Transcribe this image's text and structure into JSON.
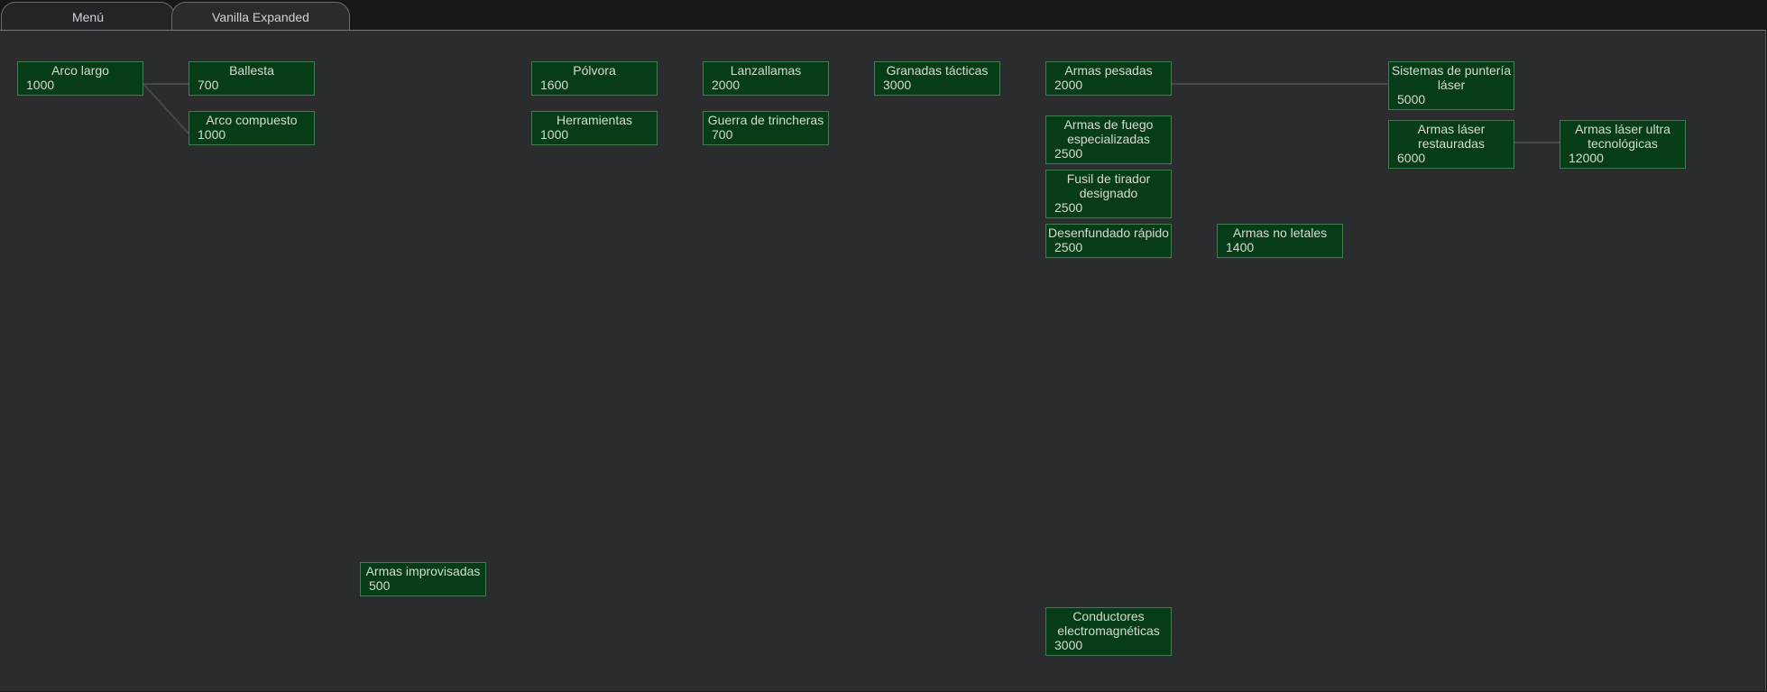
{
  "tabs": [
    {
      "label": "Menú"
    },
    {
      "label": "Vanilla Expanded"
    }
  ],
  "active_tab": "Vanilla Expanded",
  "research": {
    "arco_largo": {
      "label": "Arco largo",
      "cost": "1000"
    },
    "ballesta": {
      "label": "Ballesta",
      "cost": "700"
    },
    "arco_compuesto": {
      "label": "Arco compuesto",
      "cost": "1000"
    },
    "polvora": {
      "label": "Pólvora",
      "cost": "1600"
    },
    "herramientas": {
      "label": "Herramientas",
      "cost": "1000"
    },
    "lanzallamas": {
      "label": "Lanzallamas",
      "cost": "2000"
    },
    "guerra_trincheras": {
      "label": "Guerra de trincheras",
      "cost": "700"
    },
    "granadas": {
      "label": "Granadas tácticas",
      "cost": "3000"
    },
    "armas_pesadas": {
      "label": "Armas pesadas",
      "cost": "2000"
    },
    "armas_fuego_esp": {
      "label": "Armas de fuego especializadas",
      "cost": "2500"
    },
    "fusil_tirador": {
      "label": "Fusil de tirador designado",
      "cost": "2500"
    },
    "desenfundado": {
      "label": "Desenfundado rápido",
      "cost": "2500"
    },
    "armas_no_letales": {
      "label": "Armas no letales",
      "cost": "1400"
    },
    "sistemas_punteria": {
      "label": "Sistemas de puntería láser",
      "cost": "5000"
    },
    "armas_laser_rest": {
      "label": "Armas láser restauradas",
      "cost": "6000"
    },
    "armas_laser_ultra": {
      "label": "Armas láser ultra tecnológicas",
      "cost": "12000"
    },
    "armas_improvisadas": {
      "label": "Armas improvisadas",
      "cost": "500"
    },
    "conductores": {
      "label": "Conductores electromagnéticas",
      "cost": "3000"
    }
  },
  "colors": {
    "node_fill": "#063c17",
    "node_border": "#3f7c4e",
    "background": "#2b2c2e",
    "connector": "#46484b"
  }
}
